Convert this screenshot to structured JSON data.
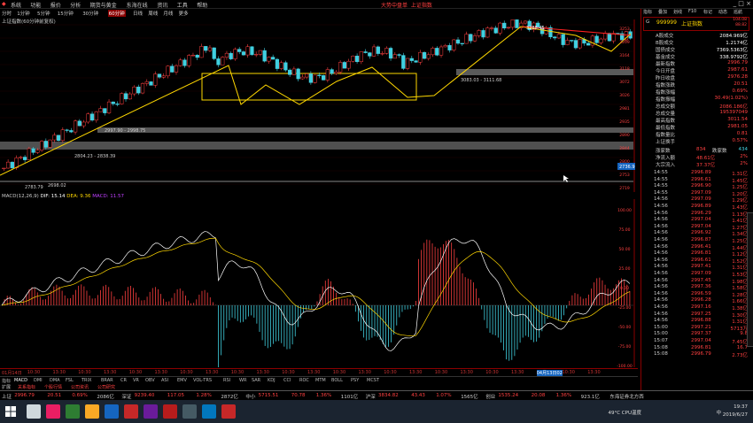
{
  "menu": {
    "items": [
      "系统",
      "功能",
      "报价",
      "分析",
      "期货与黄金",
      "东海在线",
      "资讯",
      "工具",
      "帮助"
    ],
    "center_title_a": "大势中盘单",
    "center_title_b": "上证指数",
    "window_controls": "_ □ ×"
  },
  "period_tabs": [
    "分时",
    "1分钟",
    "5分钟",
    "15分钟",
    "30分钟",
    "60分钟",
    "日线",
    "周线",
    "月线",
    "更多"
  ],
  "active_period": "60分钟",
  "chart_title": "上证指数(60分钟前复权)",
  "main_annotations": {
    "box_top_label": "3083.03 - 3111.68",
    "box_mid_label": "2997.90 - 2998.75",
    "box_low_label": "2804.23 - 2838.39",
    "low_label": "2783.79",
    "low_label2": "2698.02",
    "peak_label": "3288.45",
    "price_tag": "2736.9"
  },
  "main_axis": [
    "3253",
    "3209",
    "3164",
    "3118",
    "3072",
    "3026",
    "2981",
    "2935",
    "2890",
    "2844",
    "2800",
    "2753",
    "2719"
  ],
  "macd_title": "MACD(12,26,9)",
  "macd_values": {
    "dif": "DIF: 15.14",
    "dea": "DEA: 9.36",
    "macd": "MACD: 11.57"
  },
  "macd_axis": [
    "100.00",
    "75.00",
    "50.00",
    "25.00",
    "0.00",
    "-25.00",
    "-50.00",
    "-75.00",
    "-100.00"
  ],
  "time_labels": [
    "01月14日",
    "10:30",
    "13:30",
    "10:30",
    "13:30",
    "10:30",
    "13:30",
    "10:30",
    "13:30",
    "10:30",
    "13:30",
    "10:30",
    "13:30",
    "10:30",
    "13:30",
    "10:30",
    "13:30",
    "10:30",
    "13:30",
    "10:30",
    "13:30",
    "04月13日02",
    "10:30",
    "13:30"
  ],
  "indicator_tabs": [
    "指标",
    "MACD",
    "DMI",
    "DMA",
    "FSL",
    "TRIX",
    "BRAR",
    "CR",
    "VR",
    "OBV",
    "ASI",
    "EMV",
    "VOL-TRS",
    "RSI",
    "WR",
    "SAR",
    "KDJ",
    "CCI",
    "ROC",
    "MTM",
    "BOLL",
    "PSY",
    "MCST"
  ],
  "bottom_tabs": [
    "扩展",
    "关系指标",
    "个股行情",
    "公司资讯",
    "公司研究"
  ],
  "right_header": {
    "code": "999999",
    "name": "上证指数",
    "top_val1": "104.08",
    "top_val2": "88.82",
    "top_tabs": [
      "指标",
      "叠加",
      "划线",
      "F10",
      "标记",
      "动态",
      "巡航"
    ]
  },
  "right_stats": [
    {
      "k": "A股成交",
      "v": "2084.969亿"
    },
    {
      "k": "B股成交",
      "v": "1.2174亿"
    },
    {
      "k": "国债成交",
      "v": "7369.5363亿"
    },
    {
      "k": "基金成交",
      "v": "338.9792亿"
    },
    {
      "k": "最新指数",
      "v": "2996.79"
    },
    {
      "k": "今日开盘",
      "v": "2987.61"
    },
    {
      "k": "昨日收盘",
      "v": "2976.28"
    },
    {
      "k": "指数涨跌",
      "v": "20.51"
    },
    {
      "k": "指数涨幅",
      "v": "0.69%"
    },
    {
      "k": "指数振幅",
      "v": "30.49(1.02%)"
    },
    {
      "k": "总成交额",
      "v": "2086.186亿"
    },
    {
      "k": "总成交量",
      "v": "195397049"
    },
    {
      "k": "最高指数",
      "v": "3011.54"
    },
    {
      "k": "最低指数",
      "v": "2981.05"
    },
    {
      "k": "指数量比",
      "v": "0.81"
    },
    {
      "k": "上证换手",
      "v": "0.57%"
    }
  ],
  "flow": [
    {
      "k": "涨家数",
      "v": "834",
      "k2": "跌家数",
      "v2": "434"
    },
    {
      "k": "净流入额",
      "v": "48.61亿",
      "v3": "2%"
    },
    {
      "k": "大宗流入",
      "v": "37.37亿",
      "v3": "2%"
    }
  ],
  "ticks": [
    {
      "t": "14:55",
      "p": "2996.89",
      "v": "1.31亿"
    },
    {
      "t": "14:55",
      "p": "2996.61",
      "v": "1.45亿"
    },
    {
      "t": "14:55",
      "p": "2996.90",
      "v": "1.25亿"
    },
    {
      "t": "14:55",
      "p": "2997.09",
      "v": "1.20亿"
    },
    {
      "t": "14:56",
      "p": "2997.09",
      "v": "1.29亿"
    },
    {
      "t": "14:56",
      "p": "2996.89",
      "v": "1.43亿"
    },
    {
      "t": "14:56",
      "p": "2996.29",
      "v": "1.13亿"
    },
    {
      "t": "14:56",
      "p": "2997.04",
      "v": "1.41亿"
    },
    {
      "t": "14:56",
      "p": "2997.04",
      "v": "1.27亿"
    },
    {
      "t": "14:56",
      "p": "2996.92",
      "v": "1.34亿"
    },
    {
      "t": "14:56",
      "p": "2996.87",
      "v": "1.25亿"
    },
    {
      "t": "14:56",
      "p": "2996.41",
      "v": "1.44亿"
    },
    {
      "t": "14:56",
      "p": "2996.81",
      "v": "1.12亿"
    },
    {
      "t": "14:56",
      "p": "2996.61",
      "v": "1.52亿"
    },
    {
      "t": "14:56",
      "p": "2997.41",
      "v": "1.31亿"
    },
    {
      "t": "14:56",
      "p": "2997.09",
      "v": "1.53亿"
    },
    {
      "t": "14:56",
      "p": "2997.45",
      "v": "1.98亿"
    },
    {
      "t": "14:56",
      "p": "2997.36",
      "v": "1.58亿"
    },
    {
      "t": "14:56",
      "p": "2996.59",
      "v": "1.28亿"
    },
    {
      "t": "14:56",
      "p": "2996.28",
      "v": "1.66亿"
    },
    {
      "t": "14:56",
      "p": "2997.16",
      "v": "1.38亿"
    },
    {
      "t": "14:56",
      "p": "2997.25",
      "v": "1.30亿"
    },
    {
      "t": "14:56",
      "p": "2996.88",
      "v": "1.31亿"
    },
    {
      "t": "15:00",
      "p": "2997.21",
      "v": "5713万"
    },
    {
      "t": "15:00",
      "p": "2997.37",
      "v": "9.8"
    },
    {
      "t": "15:07",
      "p": "2997.04",
      "v": "7.45亿"
    },
    {
      "t": "15:08",
      "p": "2996.81",
      "v": "16.7"
    },
    {
      "t": "15:08",
      "p": "2996.79",
      "v": "2.73亿"
    }
  ],
  "status_bar": [
    {
      "text": "上证",
      "color": "#ccc"
    },
    {
      "text": "2996.79",
      "color": "#ff4040"
    },
    {
      "text": "20.51",
      "color": "#ff4040"
    },
    {
      "text": "0.69%",
      "color": "#ff4040"
    },
    {
      "text": "2086亿",
      "color": "#ccc"
    },
    {
      "text": "深证",
      "color": "#ccc"
    },
    {
      "text": "9239.40",
      "color": "#ff4040"
    },
    {
      "text": "117.05",
      "color": "#ff4040"
    },
    {
      "text": "1.28%",
      "color": "#ff4040"
    },
    {
      "text": "2872亿",
      "color": "#ccc"
    },
    {
      "text": "中小",
      "color": "#ccc"
    },
    {
      "text": "5715.51",
      "color": "#ff4040"
    },
    {
      "text": "70.78",
      "color": "#ff4040"
    },
    {
      "text": "1.36%",
      "color": "#ff4040"
    },
    {
      "text": "1101亿",
      "color": "#ccc"
    },
    {
      "text": "沪深",
      "color": "#ccc"
    },
    {
      "text": "3834.82",
      "color": "#ff4040"
    },
    {
      "text": "43.43",
      "color": "#ff4040"
    },
    {
      "text": "1.07%",
      "color": "#ff4040"
    },
    {
      "text": "1565亿",
      "color": "#ccc"
    },
    {
      "text": "创业",
      "color": "#ccc"
    },
    {
      "text": "1535.24",
      "color": "#ff4040"
    },
    {
      "text": "20.08",
      "color": "#ff4040"
    },
    {
      "text": "1.36%",
      "color": "#ff4040"
    },
    {
      "text": "923.1亿",
      "color": "#ccc"
    },
    {
      "text": "东海证券北方西",
      "color": "#ccc"
    }
  ],
  "taskbar": {
    "weather": "49°C CPU温度",
    "time": "19:37",
    "date": "2019/6/27",
    "lang": "中"
  },
  "colors": {
    "up": "#ff4040",
    "down": "#40d0e0",
    "yellow": "#ffd700",
    "white": "#ffffff",
    "purple": "#c040ff"
  }
}
